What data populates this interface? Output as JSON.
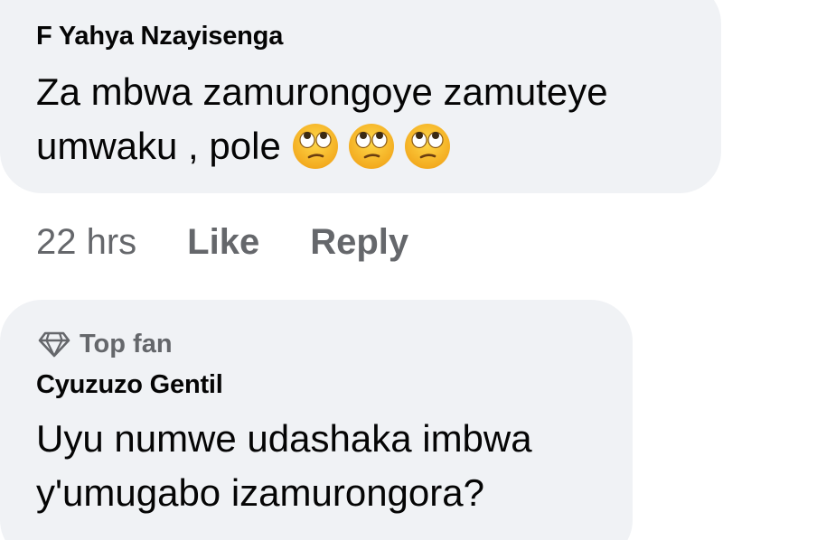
{
  "comments": [
    {
      "author": "F Yahya Nzayisenga",
      "line1": "Za mbwa zamurongoye zamuteye",
      "line2": "umwaku , pole",
      "emojis": [
        "face-with-rolling-eyes",
        "face-with-rolling-eyes",
        "face-with-rolling-eyes"
      ],
      "timestamp": "22 hrs",
      "like_label": "Like",
      "reply_label": "Reply"
    },
    {
      "badge": "Top fan",
      "badge_icon": "diamond-icon",
      "author": "Cyuzuzo Gentil",
      "line1": "Uyu numwe udashaka imbwa",
      "line2": "y'umugabo izamurongora?"
    }
  ],
  "colors": {
    "bubble": "#f0f2f5",
    "text": "#050505",
    "muted": "#65676b",
    "emoji_face": "#f7c531"
  }
}
